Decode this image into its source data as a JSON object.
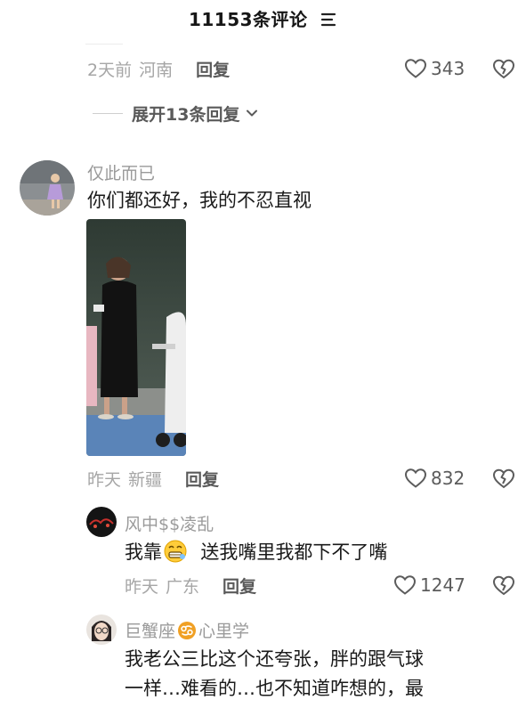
{
  "header": {
    "title": "11153条评论",
    "sort_icon": "sort-lines-icon"
  },
  "top_comment_footer": {
    "time": "2天前",
    "location": "河南",
    "reply_label": "回复",
    "likes": "343"
  },
  "expand": {
    "label": "展开13条回复"
  },
  "comments": [
    {
      "username": "仅此而已",
      "text": "你们都还好，我的不忍直视",
      "time": "昨天",
      "location": "新疆",
      "reply_label": "回复",
      "likes": "832",
      "replies": [
        {
          "username": "风中$$凌乱",
          "text_before": "我靠",
          "emoji": "grimace-emoji",
          "text_after": "送我嘴里我都下不了嘴",
          "time": "昨天",
          "location": "广东",
          "reply_label": "回复",
          "likes": "1247"
        },
        {
          "username_before": "巨蟹座",
          "username_badge": "cancer-zodiac-icon",
          "username_after": "心里学",
          "text_line1": "我老公三比这个还夸张，胖的跟气球",
          "text_line2": "一样…难看的…也不知道咋想的，最"
        }
      ]
    }
  ],
  "colors": {
    "meta": "#a6a6a6",
    "reply": "#5a5a5a",
    "text": "#1a1a1a",
    "zodiac": "#f0a024"
  }
}
